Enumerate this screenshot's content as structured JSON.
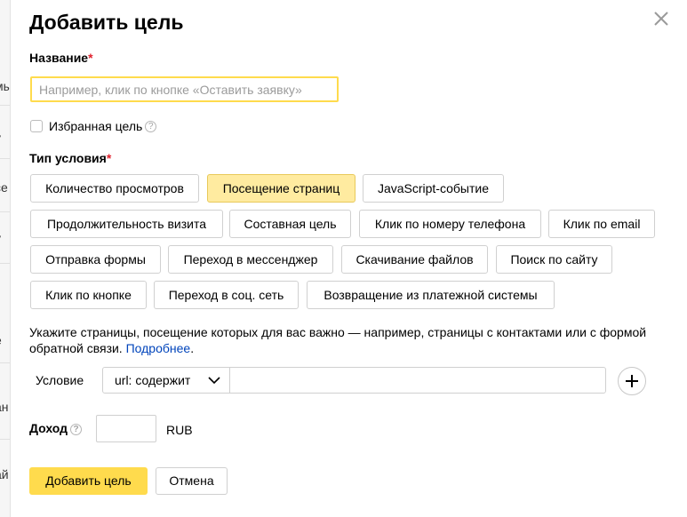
{
  "background": {
    "fragments": [
      "мы",
      "у",
      "се",
      "у",
      "е",
      "ан",
      "ай"
    ]
  },
  "dialog": {
    "title": "Добавить цель",
    "name_label": "Название",
    "required_mark": "*",
    "name_placeholder": "Например, клик по кнопке «Оставить заявку»",
    "favorite_label": "Избранная цель",
    "condition_type_label": "Тип условия",
    "condition_types": [
      "Количество просмотров",
      "Посещение страниц",
      "JavaScript-событие",
      "Продолжительность визита",
      "Составная цель",
      "Клик по номеру телефона",
      "Клик по email",
      "Отправка формы",
      "Переход в мессенджер",
      "Скачивание файлов",
      "Поиск по сайту",
      "Клик по кнопке",
      "Переход в соц. сеть",
      "Возвращение из платежной системы"
    ],
    "selected_condition_type": "Посещение страниц",
    "hint_text": "Укажите страницы, посещение которых для вас важно — например, страницы с контактами или с формой обратной связи. ",
    "hint_link": "Подробнее",
    "hint_end": ".",
    "condition_label": "Условие",
    "condition_select_value": "url: содержит",
    "condition_value": "",
    "income_label": "Доход",
    "income_value": "",
    "currency": "RUB",
    "help_glyph": "?",
    "submit_label": "Добавить цель",
    "cancel_label": "Отмена"
  },
  "colors": {
    "accent": "#ffdb4d",
    "selected_chip": "#ffeba0",
    "link": "#0044bb",
    "required": "#e0212d"
  }
}
